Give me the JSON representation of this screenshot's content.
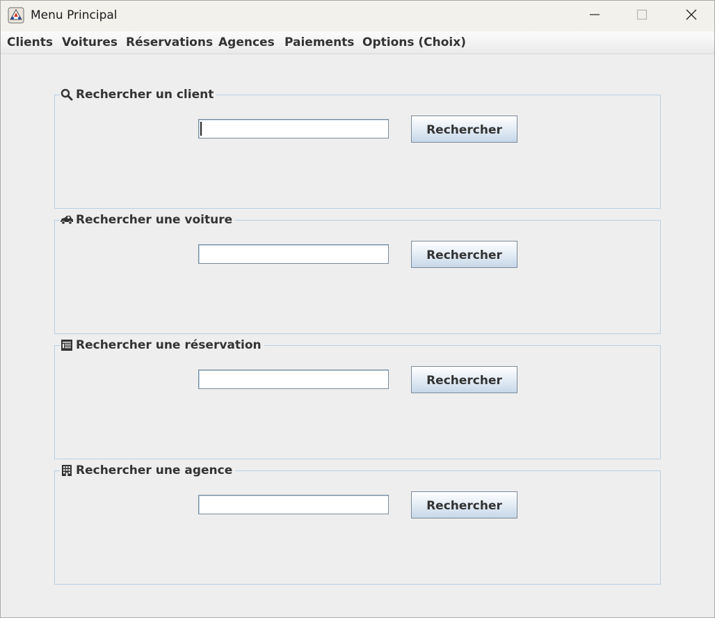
{
  "window": {
    "title": "Menu Principal",
    "icon": "java-app-icon",
    "controls": [
      "minimize-icon",
      "maximize-icon",
      "close-icon"
    ]
  },
  "menubar": {
    "items": [
      {
        "label": "Clients"
      },
      {
        "label": "Voitures"
      },
      {
        "label": "Réservations"
      },
      {
        "label": "Agences"
      },
      {
        "label": "Paiements"
      },
      {
        "label": "Options (Choix)"
      }
    ]
  },
  "panels": [
    {
      "title": "Rechercher un client",
      "icon": "search-icon",
      "input_value": "",
      "button_label": "Rechercher",
      "focused": true
    },
    {
      "title": "Rechercher une voiture",
      "icon": "car-icon",
      "input_value": "",
      "button_label": "Rechercher",
      "focused": false
    },
    {
      "title": "Rechercher une réservation",
      "icon": "calendar-icon",
      "input_value": "",
      "button_label": "Rechercher",
      "focused": false
    },
    {
      "title": "Rechercher une agence",
      "icon": "building-icon",
      "input_value": "",
      "button_label": "Rechercher",
      "focused": false
    }
  ],
  "colors": {
    "panel_border": "#b8cfe5",
    "button_gradient_bottom": "#c7d7e8",
    "text": "#333333"
  }
}
